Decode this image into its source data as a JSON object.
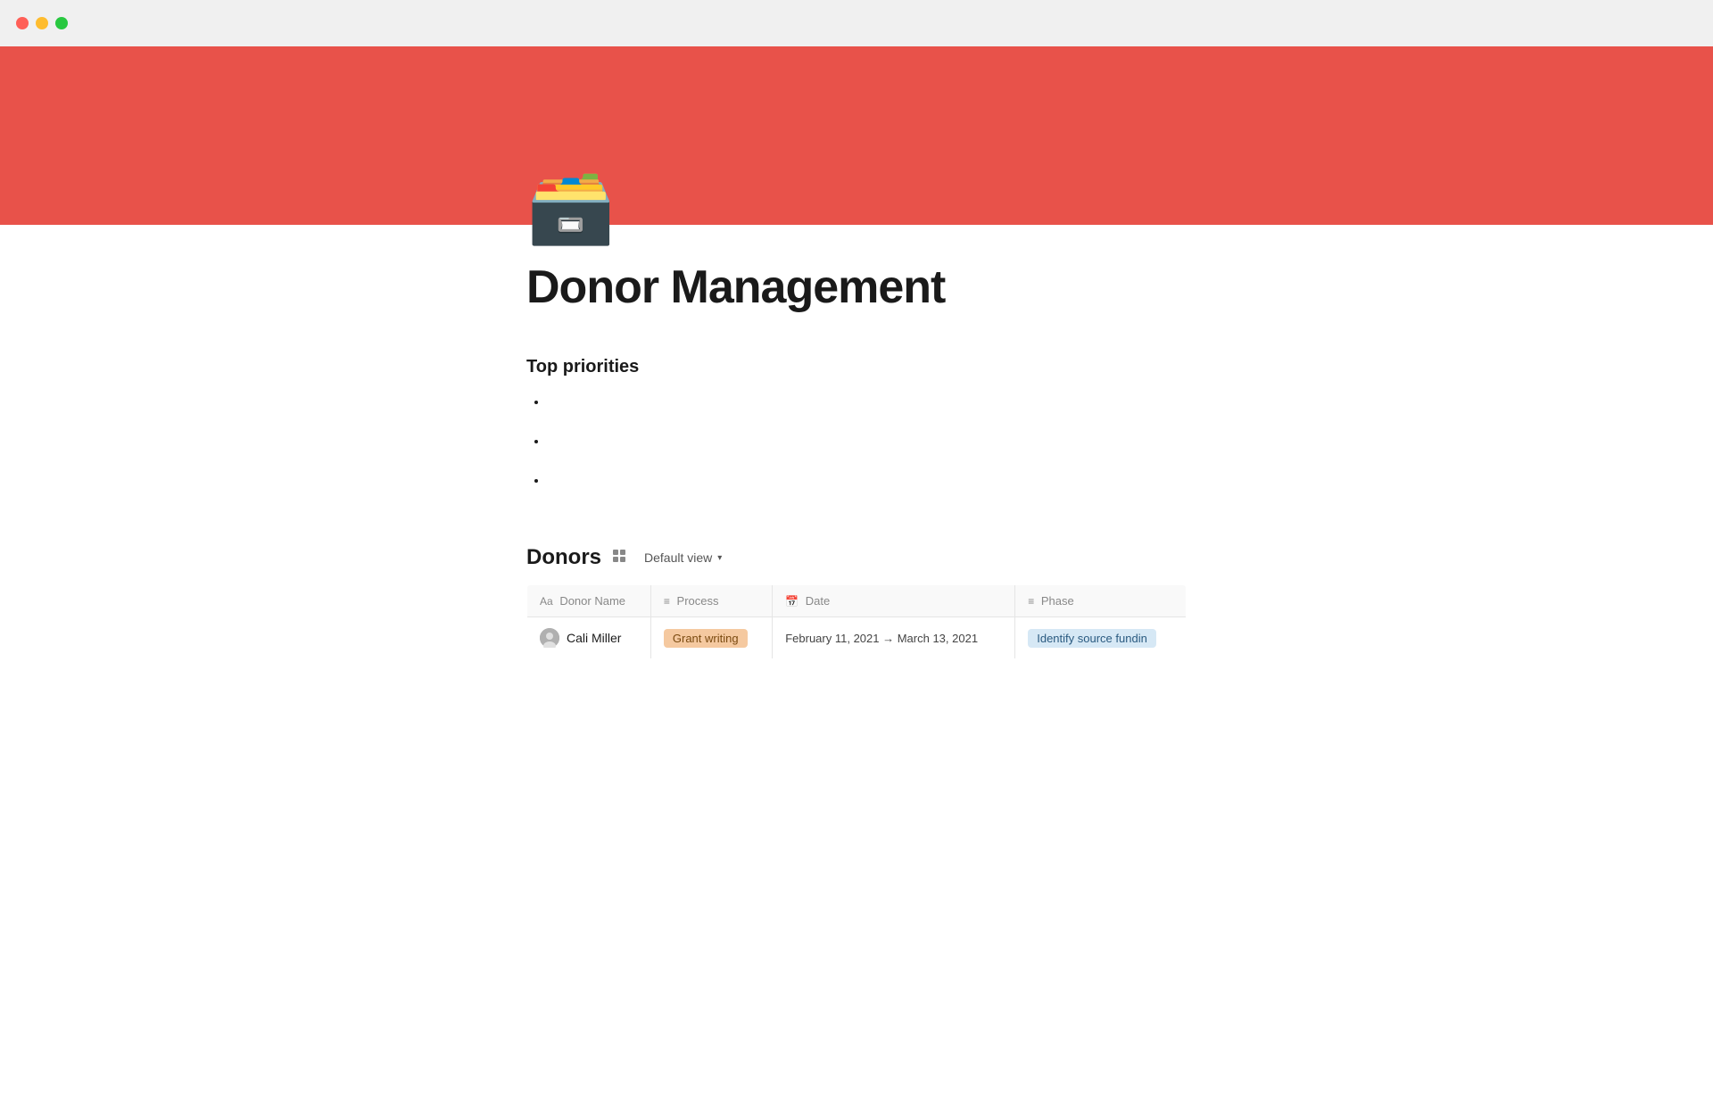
{
  "window": {
    "traffic": {
      "close_label": "",
      "minimize_label": "",
      "maximize_label": ""
    }
  },
  "header": {
    "banner_color": "#e8524a"
  },
  "page": {
    "icon": "🗃️",
    "title": "Donor Management",
    "priorities_heading": "Top priorities",
    "priorities": [
      {
        "text": ""
      },
      {
        "text": ""
      },
      {
        "text": ""
      }
    ]
  },
  "donors_db": {
    "title": "Donors",
    "view_label": "Default view",
    "columns": [
      {
        "icon": "Aa",
        "label": "Donor Name"
      },
      {
        "icon": "≡",
        "label": "Process"
      },
      {
        "icon": "📅",
        "label": "Date"
      },
      {
        "icon": "≡",
        "label": "Phase"
      }
    ],
    "rows": [
      {
        "donor_name": "Cali Miller",
        "process": "Grant writing",
        "date": "February 11, 2021 → March 13, 2021",
        "phase": "Identify source fundin"
      }
    ]
  }
}
